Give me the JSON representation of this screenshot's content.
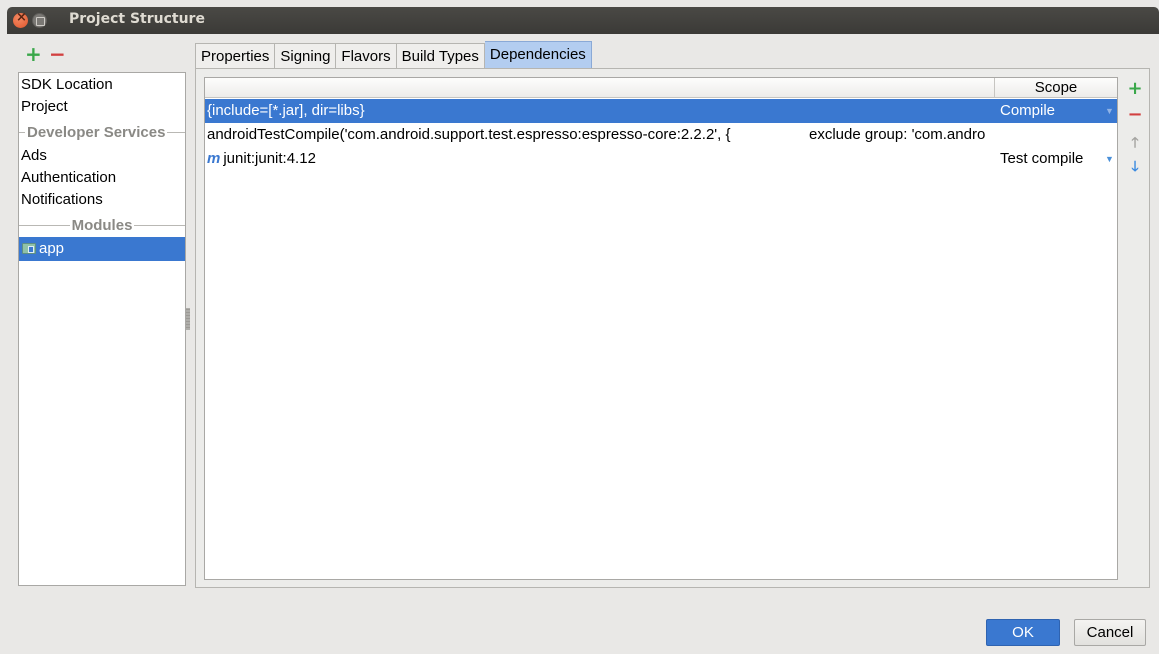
{
  "window": {
    "title": "Project Structure"
  },
  "left_toolbar": {
    "add_icon": "+",
    "remove_icon": "−"
  },
  "sidebar": {
    "items": [
      {
        "label": "SDK Location"
      },
      {
        "label": "Project"
      }
    ],
    "developer_services_header": "Developer Services",
    "developer_services": [
      {
        "label": "Ads"
      },
      {
        "label": "Authentication"
      },
      {
        "label": "Notifications"
      }
    ],
    "modules_header": "Modules",
    "modules": [
      {
        "label": "app",
        "selected": true
      }
    ]
  },
  "tabs": [
    {
      "label": "Properties"
    },
    {
      "label": "Signing"
    },
    {
      "label": "Flavors"
    },
    {
      "label": "Build Types"
    },
    {
      "label": "Dependencies",
      "active": true
    }
  ],
  "dependencies": {
    "columns": {
      "dependency": "",
      "scope": "Scope"
    },
    "rows": [
      {
        "dependency": "{include=[*.jar], dir=libs}",
        "extra": "",
        "scope": "Compile",
        "selected": true,
        "has_combo": true
      },
      {
        "dependency": "androidTestCompile('com.android.support.test.espresso:espresso-core:2.2.2', {",
        "extra": "exclude group: 'com.andro",
        "scope": "",
        "selected": false,
        "has_combo": false
      },
      {
        "icon": "m",
        "dependency": "junit:junit:4.12",
        "extra": "",
        "scope": "Test compile",
        "selected": false,
        "has_combo": true
      }
    ]
  },
  "side_toolbar": {
    "add_icon": "+",
    "remove_icon": "−",
    "up_icon": "🡑",
    "down_icon": "🡓"
  },
  "buttons": {
    "ok": "OK",
    "cancel": "Cancel"
  },
  "colors": {
    "accent": "#3a78d0",
    "add": "#3aa74a",
    "remove": "#d24040",
    "titlebar": "#3b3a37"
  }
}
